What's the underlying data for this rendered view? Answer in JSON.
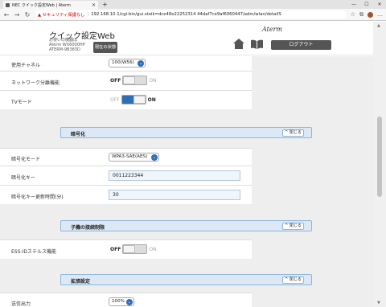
{
  "browser": {
    "tab_title": "NEC クイック設定Web | Aterm",
    "tab_close": "✕",
    "new_tab": "+",
    "win_min": "—",
    "win_max": "☐",
    "win_close": "✕",
    "back": "←",
    "forward": "→",
    "reload": "↻",
    "warning": "▲ セキュリティ保護なし",
    "url": "192.168.10.1/cgi-bin/gui.stoik=dce48e22252314 44daf7ce9af6060447/adm/wlan/detailS",
    "sep": "|",
    "star": "☆",
    "collections": "⧉",
    "menu": "…"
  },
  "header": {
    "title": "クイック設定Web",
    "sub1": "お使いの機器は",
    "sub2": "Aterm WX6000HP",
    "sub3": "ATERM-9B383D",
    "status_button": "現在の状態",
    "logo": "Aterm",
    "logout": "ログアウト"
  },
  "rows": {
    "channel_label": "使用チャネル",
    "channel_value": "100(W56)",
    "separation_label": "ネットワーク分離機能",
    "tv_label": "TVモード",
    "off": "OFF",
    "on": "ON"
  },
  "encryption": {
    "title": "暗号化",
    "collapse": "閉じる",
    "mode_label": "暗号化モード",
    "mode_value": "WPA3-SAE(AES)",
    "key_label": "暗号化キー",
    "key_value": "0011223344",
    "update_label": "暗号化キー更新時間(分)",
    "update_value": "30"
  },
  "client": {
    "title": "子機の接続制限",
    "collapse": "閉じる",
    "stealth_label": "ESS-IDステルス機能"
  },
  "extended": {
    "title": "拡張設定",
    "collapse": "閉じる",
    "power_label": "送信出力",
    "power_value": "100%"
  },
  "colors": {
    "accent": "#2f6fb7",
    "section_header": "#dce8f5"
  }
}
